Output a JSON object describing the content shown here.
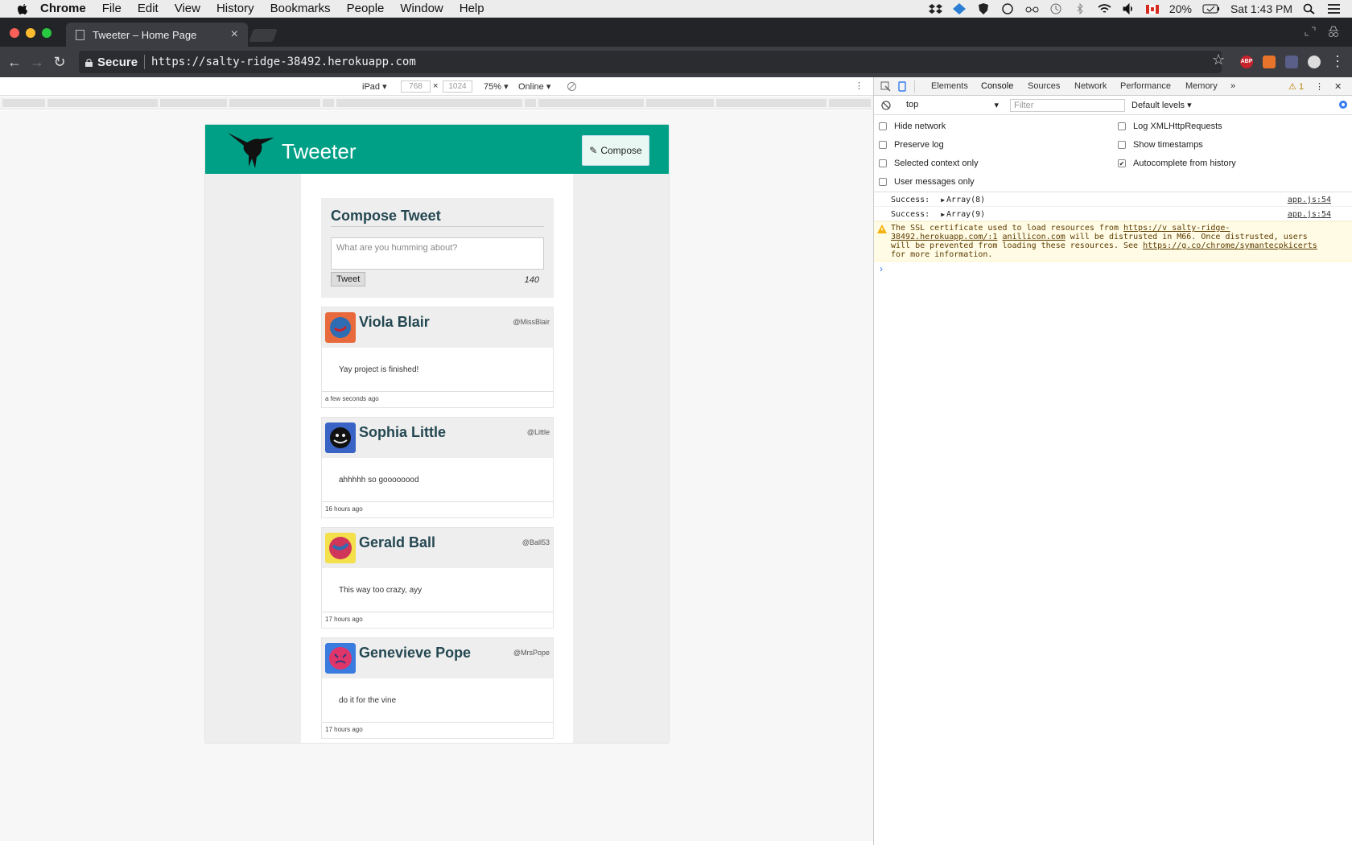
{
  "menubar": {
    "items": [
      "Chrome",
      "File",
      "Edit",
      "View",
      "History",
      "Bookmarks",
      "People",
      "Window",
      "Help"
    ],
    "battery": "20%",
    "clock": "Sat 1:43 PM"
  },
  "browser": {
    "tab_title": "Tweeter – Home Page",
    "secure_label": "Secure",
    "url": "https://salty-ridge-38492.herokuapp.com",
    "ext_abp": "ABP"
  },
  "device_toolbar": {
    "device": "iPad",
    "width": "768",
    "height": "1024",
    "times": "×",
    "zoom": "75%",
    "throttle": "Online"
  },
  "app": {
    "brand": "Tweeter",
    "compose_button": "Compose",
    "compose_title": "Compose Tweet",
    "placeholder": "What are you humming about?",
    "tweet_button": "Tweet",
    "counter": "140",
    "tweets": [
      {
        "name": "Viola Blair",
        "handle": "@MissBlair",
        "text": "Yay project is finished!",
        "time": "a few seconds ago",
        "avatar_bg": "#e86a3c",
        "avatar_fg": "#2e6db3"
      },
      {
        "name": "Sophia Little",
        "handle": "@Little",
        "text": "ahhhhh so goooooood",
        "time": "16 hours ago",
        "avatar_bg": "#3a63c6",
        "avatar_fg": "#111111"
      },
      {
        "name": "Gerald Ball",
        "handle": "@Ball53",
        "text": "This way too crazy, ayy",
        "time": "17 hours ago",
        "avatar_bg": "#f4e04a",
        "avatar_fg": "#d0365a"
      },
      {
        "name": "Genevieve Pope",
        "handle": "@MrsPope",
        "text": "do it for the vine",
        "time": "17 hours ago",
        "avatar_bg": "#3a7be0",
        "avatar_fg": "#e0356a"
      }
    ]
  },
  "devtools": {
    "tabs": [
      "Elements",
      "Console",
      "Sources",
      "Network",
      "Performance",
      "Memory"
    ],
    "more": "»",
    "warning_count": "1",
    "context": "top",
    "filter_placeholder": "Filter",
    "levels": "Default levels",
    "options": [
      {
        "label": "Hide network",
        "checked": false
      },
      {
        "label": "Log XMLHttpRequests",
        "checked": false
      },
      {
        "label": "Preserve log",
        "checked": false
      },
      {
        "label": "Show timestamps",
        "checked": false
      },
      {
        "label": "Selected context only",
        "checked": false
      },
      {
        "label": "Autocomplete from history",
        "checked": true
      },
      {
        "label": "User messages only",
        "checked": false
      }
    ],
    "logs": [
      {
        "prefix": "Success:",
        "value": "Array(8)",
        "source": "app.js:54"
      },
      {
        "prefix": "Success:",
        "value": "Array(9)",
        "source": "app.js:54"
      }
    ],
    "warning": {
      "text_1": "The SSL certificate used to load resources from",
      "link_1": "https://v salty-ridge-38492.herokuapp.com/:1",
      "link_1b": "anillicon.com",
      "text_2": "will be distrusted in M66. Once distrusted, users will be prevented from loading these resources. See",
      "link_2": "https://g.co/chrome/symantecpkicerts",
      "text_3": "for more information."
    },
    "prompt": "›"
  },
  "colors": {
    "header": "#00a087",
    "title_text": "#244751"
  }
}
